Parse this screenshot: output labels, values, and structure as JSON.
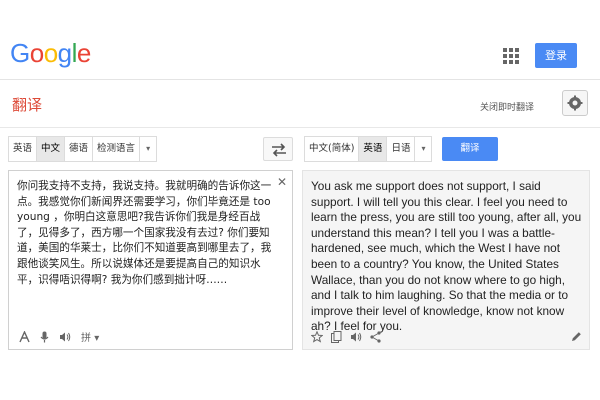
{
  "header": {
    "logo_letters": [
      {
        "char": "G",
        "color": "#4285f4"
      },
      {
        "char": "o",
        "color": "#ea4335"
      },
      {
        "char": "o",
        "color": "#fbbc05"
      },
      {
        "char": "g",
        "color": "#4285f4"
      },
      {
        "char": "l",
        "color": "#34a853"
      },
      {
        "char": "e",
        "color": "#ea4335"
      }
    ],
    "signin_label": "登录",
    "icons": {
      "apps": "apps-grid-icon"
    }
  },
  "subhead": {
    "title": "翻译",
    "instant_off_label": "关闭即时翻译",
    "icons": {
      "settings": "gear-icon"
    }
  },
  "source_langbar": {
    "languages": [
      "英语",
      "中文",
      "德语",
      "检测语言"
    ],
    "selected_index": 1,
    "dropdown_glyph": "▾"
  },
  "target_langbar": {
    "languages": [
      "中文(简体)",
      "英语",
      "日语"
    ],
    "selected_index": 1,
    "dropdown_glyph": "▾",
    "translate_label": "翻译"
  },
  "source": {
    "text": "你问我支持不支持，我说支持。我就明确的告诉你这一点。我感觉你们新闻界还需要学习，你们毕竟还是 too young ，你明白这意思吧?我告诉你们我是身经百战了，见得多了，西方哪一个国家我没有去过? 你们要知道，美国的华莱士，比你们不知道要高到哪里去了，我跟他谈笑风生。所以说媒体还是要提高自己的知识水平，识得唔识得啊? 我为你们感到拙计呀……",
    "clear_glyph": "✕",
    "tools": {
      "input_tools_glyph": "拼",
      "tools_dropdown": "▾"
    }
  },
  "output": {
    "text": "You ask me support does not support, I said support. I will tell you this clear. I feel you need to learn the press, you are still too young, after all, you understand this mean? I tell you I was a battle-hardened, see much, which the West I have not been to a country? You know, the United States Wallace, than you do not know where to go high, and I talk to him laughing. So that the media or to improve their level of knowledge, know not know ah? I feel for you."
  },
  "colors": {
    "accent_blue": "#4a8af4",
    "title_red": "#dd4b39"
  }
}
